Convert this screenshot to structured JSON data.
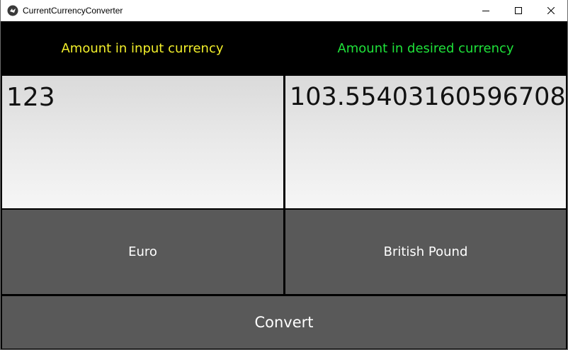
{
  "window": {
    "title": "CurrentCurrencyConverter",
    "app_icon": "kivy-logo-icon",
    "controls": [
      "minimize-icon",
      "maximize-icon",
      "close-icon"
    ]
  },
  "labels": {
    "input_currency": "Amount in input currency",
    "desired_currency": "Amount in desired currency"
  },
  "fields": {
    "input_amount": "123",
    "output_amount": "103.55403160596708"
  },
  "buttons": {
    "from_currency": "Euro",
    "to_currency": "British Pound",
    "convert": "Convert"
  },
  "colors": {
    "input_label": "#f2ef2a",
    "desired_label": "#1fe23a",
    "button_bg": "#595959",
    "background": "#000000"
  }
}
